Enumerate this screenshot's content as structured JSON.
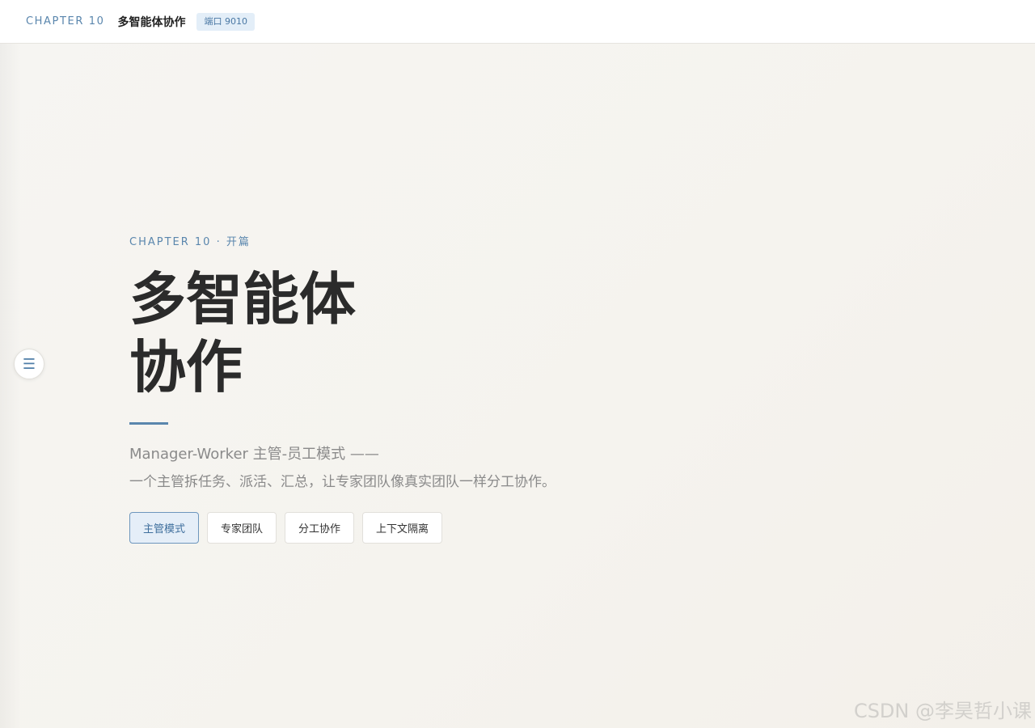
{
  "header": {
    "chapter": "CHAPTER 10",
    "title": "多智能体协作",
    "port_badge": "端口 9010"
  },
  "menu_toggle": {
    "icon": "menu-icon",
    "glyph": "☰"
  },
  "hero": {
    "eyebrow": "CHAPTER 10 · 开篇",
    "headline_line1": "多智能体",
    "headline_line2": "协作",
    "subtitle": "Manager-Worker 主管-员工模式 ——",
    "description": "一个主管拆任务、派活、汇总，让专家团队像真实团队一样分工协作。",
    "chips": [
      {
        "label": "主管模式",
        "active": true
      },
      {
        "label": "专家团队",
        "active": false
      },
      {
        "label": "分工协作",
        "active": false
      },
      {
        "label": "上下文隔离",
        "active": false
      }
    ]
  },
  "watermark": "CSDN @李昊哲小课",
  "colors": {
    "accent": "#5a86ad",
    "headline": "#2b2b2b",
    "muted": "#8a8a8a",
    "background": "#f5f3ee"
  }
}
